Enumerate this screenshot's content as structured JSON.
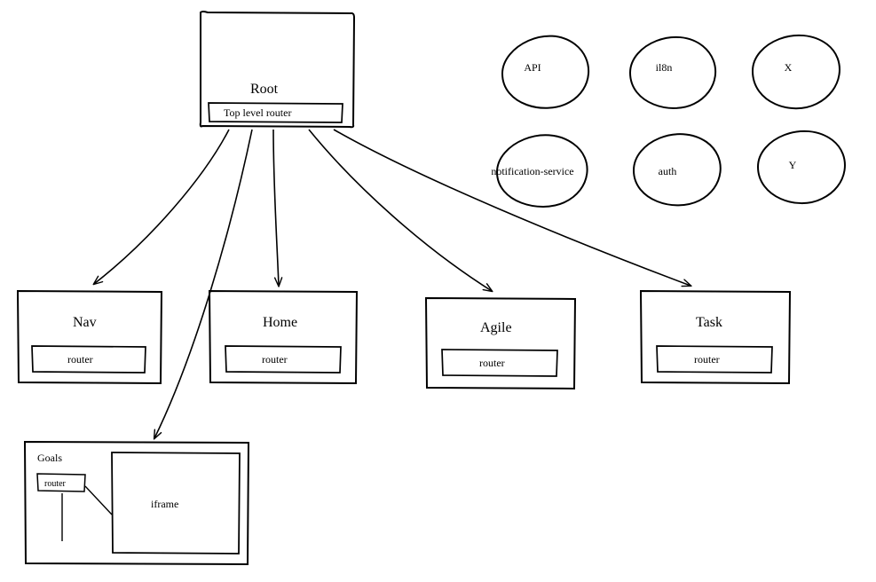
{
  "root": {
    "title": "Root",
    "router_label": "Top level router"
  },
  "children": {
    "nav": {
      "title": "Nav",
      "router_label": "router"
    },
    "home": {
      "title": "Home",
      "router_label": "router"
    },
    "agile": {
      "title": "Agile",
      "router_label": "router"
    },
    "task": {
      "title": "Task",
      "router_label": "router"
    },
    "goals": {
      "title": "Goals",
      "router_label": "router",
      "iframe_label": "iframe"
    }
  },
  "services": {
    "api": "API",
    "il8n": "il8n",
    "x": "X",
    "notification": "notification-service",
    "auth": "auth",
    "y": "Y"
  }
}
